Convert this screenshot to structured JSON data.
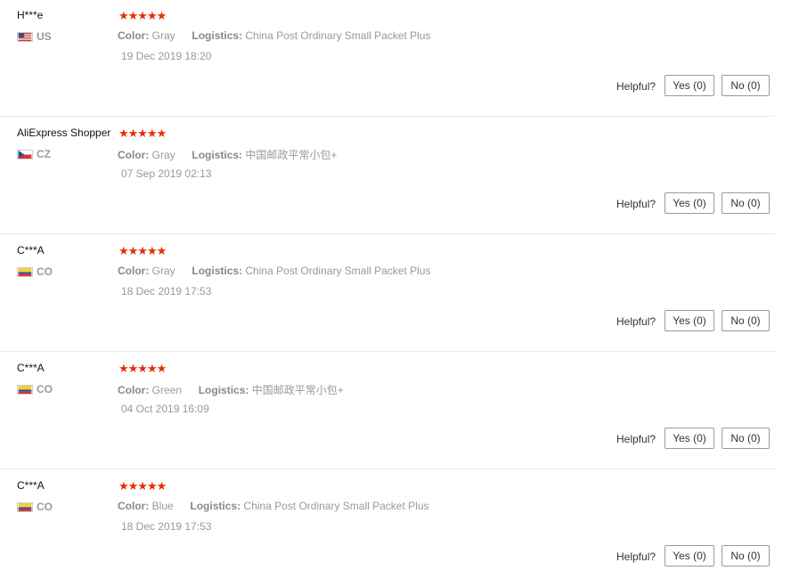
{
  "helpful_label": "Helpful?",
  "star_glyphs": "★★★★★",
  "reviews": [
    {
      "name": "H***e",
      "country": "US",
      "flag": "us",
      "color_label": "Color:",
      "color": "Gray",
      "logistics_label": "Logistics:",
      "logistics": "China Post Ordinary Small Packet Plus",
      "date": "19 Dec 2019 18:20",
      "yes": "Yes (0)",
      "no": "No (0)"
    },
    {
      "name": "AliExpress Shopper",
      "country": "CZ",
      "flag": "cz",
      "color_label": "Color:",
      "color": "Gray",
      "logistics_label": "Logistics:",
      "logistics": "中国邮政平常小包+",
      "date": "07 Sep 2019 02:13",
      "yes": "Yes (0)",
      "no": "No (0)"
    },
    {
      "name": "C***A",
      "country": "CO",
      "flag": "co",
      "color_label": "Color:",
      "color": "Gray",
      "logistics_label": "Logistics:",
      "logistics": "China Post Ordinary Small Packet Plus",
      "date": "18 Dec 2019 17:53",
      "yes": "Yes (0)",
      "no": "No (0)"
    },
    {
      "name": "C***A",
      "country": "CO",
      "flag": "co",
      "color_label": "Color:",
      "color": "Green",
      "logistics_label": "Logistics:",
      "logistics": "中国邮政平常小包+",
      "date": "04 Oct 2019 16:09",
      "yes": "Yes (0)",
      "no": "No (0)"
    },
    {
      "name": "C***A",
      "country": "CO",
      "flag": "co",
      "color_label": "Color:",
      "color": "Blue",
      "logistics_label": "Logistics:",
      "logistics": "China Post Ordinary Small Packet Plus",
      "date": "18 Dec 2019 17:53",
      "yes": "Yes (0)",
      "no": "No (0)"
    }
  ]
}
